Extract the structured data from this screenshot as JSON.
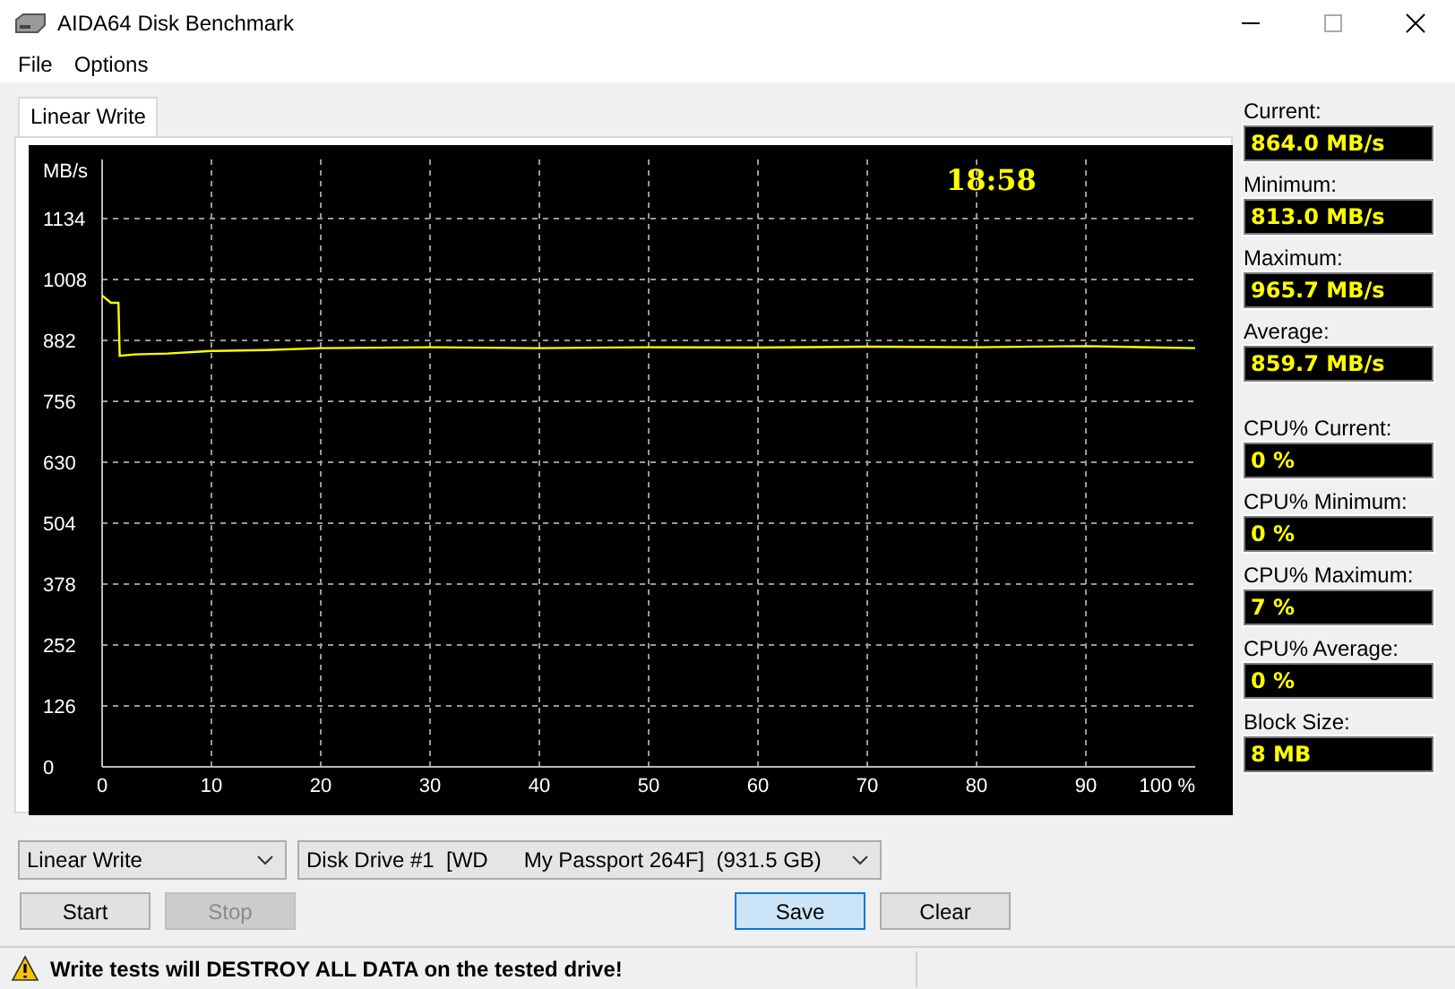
{
  "window": {
    "title": "AIDA64 Disk Benchmark"
  },
  "menu": [
    "File",
    "Options"
  ],
  "tabs": [
    {
      "label": "Linear Write",
      "selected": true
    }
  ],
  "chart": {
    "elapsed_time": "18:58",
    "chart_data": {
      "type": "line",
      "grid": true,
      "ylabel": "MB/s",
      "xlim": [
        0,
        100
      ],
      "ylim": [
        0,
        1134
      ],
      "xticks": [
        0,
        10,
        20,
        30,
        40,
        50,
        60,
        70,
        80,
        90,
        {
          "value": 100,
          "label": "100 %"
        }
      ],
      "yticks": [
        0,
        126,
        252,
        378,
        504,
        630,
        756,
        882,
        1008,
        1134
      ],
      "x": [
        0,
        0.8,
        1.5,
        1.6,
        3,
        6,
        10,
        15,
        20,
        30,
        40,
        50,
        60,
        70,
        80,
        90,
        100
      ],
      "series": [
        {
          "color": "#ffff00",
          "values": [
            975,
            960,
            960,
            850,
            853,
            855,
            860,
            862,
            866,
            868,
            866,
            868,
            867,
            869,
            868,
            870,
            866
          ]
        }
      ]
    }
  },
  "stats": [
    {
      "label": "Current:",
      "value": "864.0 MB/s"
    },
    {
      "label": "Minimum:",
      "value": "813.0 MB/s"
    },
    {
      "label": "Maximum:",
      "value": "965.7 MB/s"
    },
    {
      "label": "Average:",
      "value": "859.7 MB/s"
    },
    {
      "label": "CPU% Current:",
      "value": "0 %"
    },
    {
      "label": "CPU% Minimum:",
      "value": "0 %"
    },
    {
      "label": "CPU% Maximum:",
      "value": "7 %"
    },
    {
      "label": "CPU% Average:",
      "value": "0 %"
    }
  ],
  "block_size": {
    "label": "Block Size:",
    "value": "8 MB"
  },
  "test_select": {
    "value": "Linear Write"
  },
  "drive_select": {
    "value": "Disk Drive #1  [WD      My Passport 264F]  (931.5 GB)"
  },
  "buttons": [
    {
      "label": "Start",
      "disabled": false,
      "focused": false
    },
    {
      "label": "Stop",
      "disabled": true,
      "focused": false
    },
    {
      "label": "Save",
      "disabled": false,
      "focused": true
    },
    {
      "label": "Clear",
      "disabled": false,
      "focused": false
    }
  ],
  "status_bar": {
    "warning": "Write tests will DESTROY ALL DATA on the tested drive!"
  }
}
